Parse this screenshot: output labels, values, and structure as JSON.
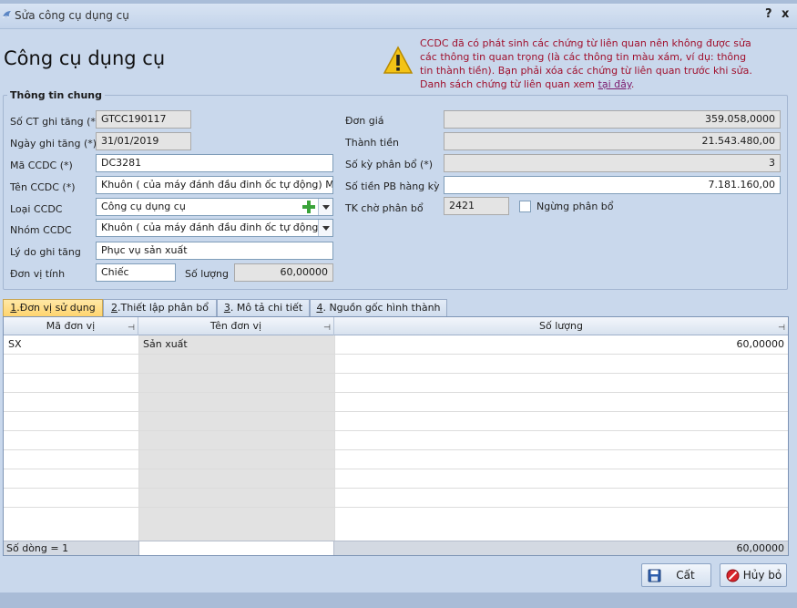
{
  "window": {
    "title": "Sửa công cụ dụng cụ",
    "help": "?",
    "close": "x"
  },
  "heading": "Công cụ dụng cụ",
  "warning": {
    "text": "CCDC đã có phát sinh các chứng từ liên quan nên không được sửa các thông tin quan trọng (là các thông tin màu xám, ví dụ: thông tin thành tiền). Bạn phải xóa các chứng từ liên quan trước khi sửa. Danh sách chứng từ liên quan xem",
    "link": "tại đây",
    "end": "."
  },
  "general": {
    "legend": "Thông tin chung",
    "labels": {
      "so_ct": "Số CT ghi tăng (*)",
      "ngay": "Ngày ghi tăng (*)",
      "ma": "Mã CCDC (*)",
      "ten": "Tên CCDC (*)",
      "loai": "Loại CCDC",
      "nhom": "Nhóm CCDC",
      "lydo": "Lý do ghi tăng",
      "dvt": "Đơn vị tính",
      "soluong": "Số lượng",
      "dongia": "Đơn giá",
      "thanhtien": "Thành tiền",
      "soky": "Số kỳ phân bổ (*)",
      "sotienpb": "Số tiền PB hàng kỳ",
      "tk": "TK chờ phân bổ",
      "ngung": "Ngừng phân bổ"
    },
    "values": {
      "so_ct": "GTCC190117",
      "ngay": "31/01/2019",
      "ma": "DC3281",
      "ten": "Khuôn ( của máy đánh đầu đinh ốc tự động) MOU",
      "loai": "Công cụ dụng cụ",
      "nhom": "Khuôn ( của máy đánh đầu đinh ốc tự động)",
      "lydo": "Phục vụ sản xuất",
      "dvt": "Chiếc",
      "soluong": "60,00000",
      "dongia": "359.058,0000",
      "thanhtien": "21.543.480,00",
      "soky": "3",
      "sotienpb": "7.181.160,00",
      "tk": "2421"
    }
  },
  "tabs": [
    {
      "num": "1",
      "label": ".Đơn vị sử dụng"
    },
    {
      "num": "2",
      "label": ".Thiết lập phân bổ"
    },
    {
      "num": "3",
      "label": ". Mô tả chi tiết"
    },
    {
      "num": "4",
      "label": ". Nguồn gốc hình thành"
    }
  ],
  "grid": {
    "columns": [
      "Mã đơn vị",
      "Tên đơn vị",
      "Số lượng"
    ],
    "rows": [
      {
        "ma": "SX",
        "ten": "Sản xuất",
        "sl": "60,00000"
      }
    ],
    "footer": {
      "count": "Số dòng = 1",
      "total": "60,00000"
    }
  },
  "buttons": {
    "save": "Cất",
    "cancel": "Hủy bỏ"
  },
  "colors": {
    "warning_text": "#a0102d",
    "active_tab": "#ffd36b",
    "window_bg": "#c9d8ec"
  }
}
